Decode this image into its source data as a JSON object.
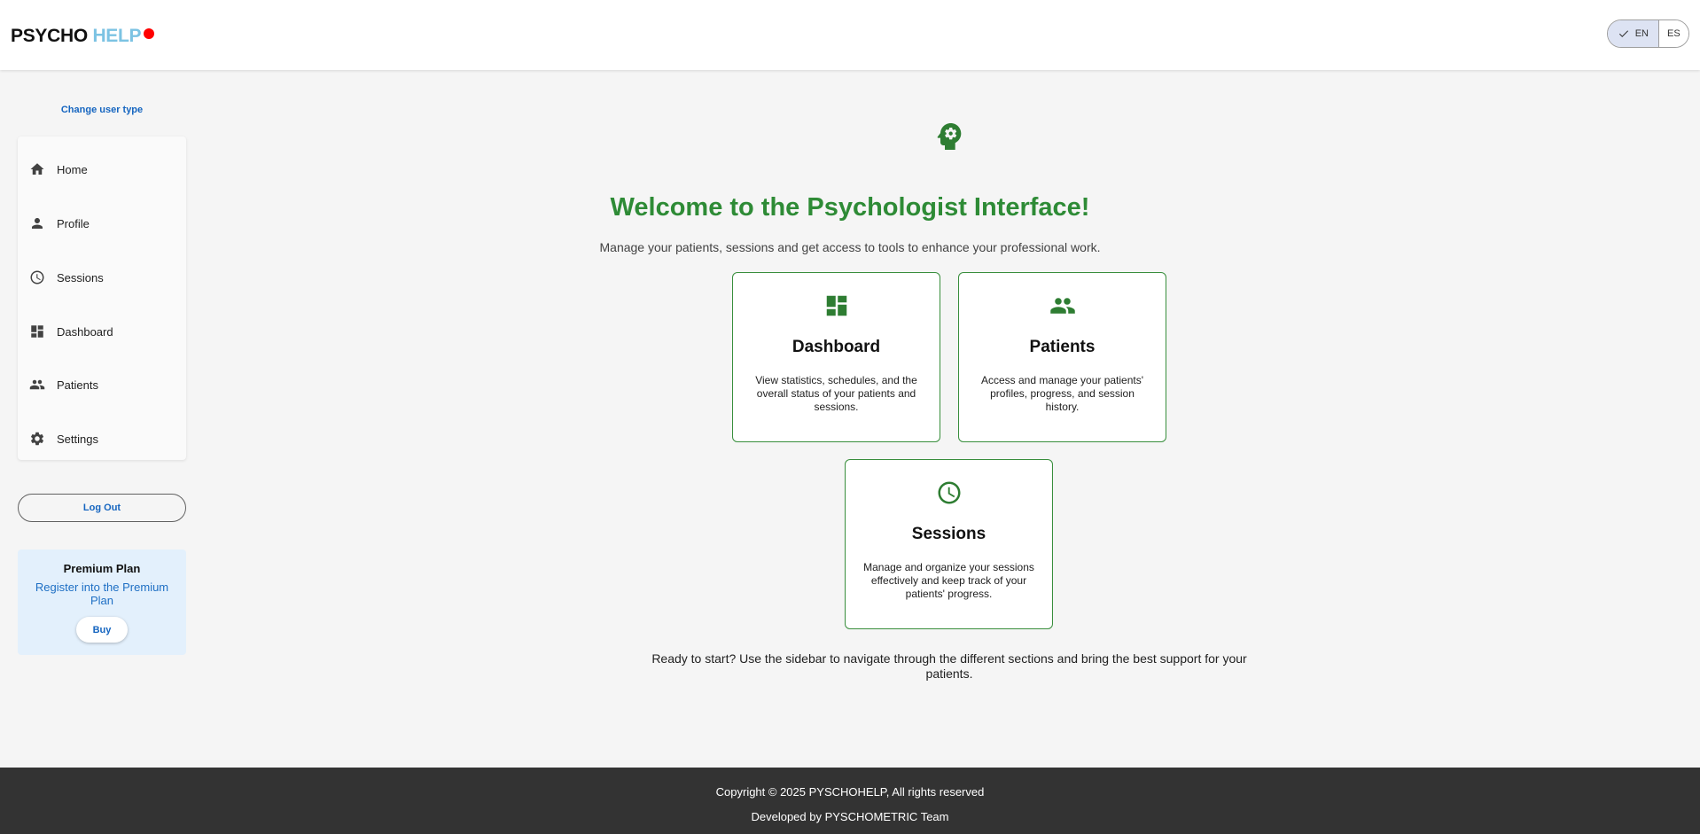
{
  "header": {
    "logo_part1": "PSYCHO",
    "logo_part2": "HELP",
    "status_color": "#ff0000",
    "languages": [
      {
        "code": "EN",
        "selected": true
      },
      {
        "code": "ES",
        "selected": false
      }
    ]
  },
  "sidebar": {
    "change_user_type": "Change user type",
    "items": [
      {
        "label": "Home",
        "icon": "home-icon"
      },
      {
        "label": "Profile",
        "icon": "person-icon"
      },
      {
        "label": "Sessions",
        "icon": "clock-icon"
      },
      {
        "label": "Dashboard",
        "icon": "dashboard-icon"
      },
      {
        "label": "Patients",
        "icon": "people-icon"
      },
      {
        "label": "Settings",
        "icon": "gear-icon"
      }
    ],
    "logout_label": "Log Out",
    "premium": {
      "title": "Premium Plan",
      "link": "Register into the Premium Plan",
      "buy_label": "Buy"
    }
  },
  "main": {
    "hero_icon": "psychology-head-gear-icon",
    "title": "Welcome to the Psychologist Interface!",
    "subtitle": "Manage your patients, sessions and get access to tools to enhance your professional work.",
    "cards": [
      {
        "title": "Dashboard",
        "icon": "dashboard-icon",
        "description": "View statistics, schedules, and the overall status of your patients and sessions."
      },
      {
        "title": "Patients",
        "icon": "people-icon",
        "description": "Access and manage your patients' profiles, progress, and session history."
      },
      {
        "title": "Sessions",
        "icon": "clock-icon",
        "description": "Manage and organize your sessions effectively and keep track of your patients' progress."
      }
    ],
    "ready_text": "Ready to start? Use the sidebar to navigate through the different sections and bring the best support for your patients."
  },
  "footer": {
    "copyright": "Copyright © 2025 PYSCHOHELP, All rights reserved",
    "developed_by": "Developed by PYSCHOMETRIC Team"
  },
  "colors": {
    "accent_green": "#2e8b36",
    "link_blue": "#1565c0",
    "footer_bg": "#333333",
    "premium_bg": "#e3f0fc"
  }
}
